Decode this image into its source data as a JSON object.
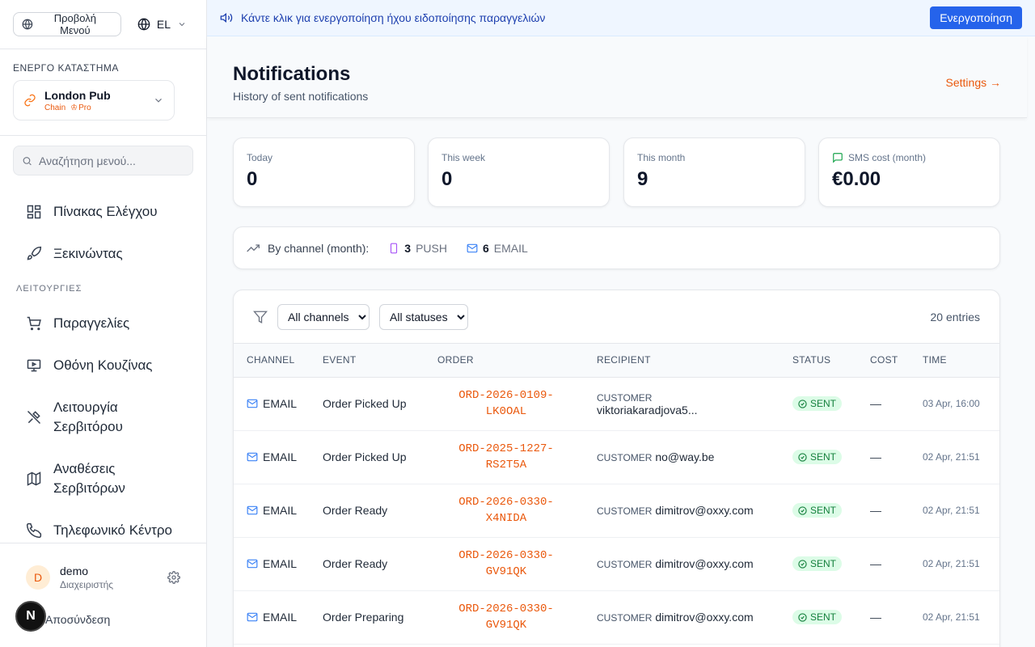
{
  "sidebar": {
    "menu_view_label": "Προβολή Μενού",
    "language": "EL",
    "store_caption": "ΕΝΕΡΓΟ ΚΑΤΑΣΤΗΜΑ",
    "store_name": "London Pub",
    "store_type": "Chain",
    "store_plan": "Pro",
    "search_placeholder": "Αναζήτηση μενού...",
    "nav_top": [
      {
        "label": "Πίνακας Ελέγχου",
        "icon": "dashboard-icon"
      },
      {
        "label": "Ξεκινώντας",
        "icon": "rocket-icon"
      }
    ],
    "section_label": "ΛΕΙΤΟΥΡΓΙΕΣ",
    "nav_ops": [
      {
        "label": "Παραγγελίες",
        "icon": "cart-icon"
      },
      {
        "label": "Οθόνη Κουζίνας",
        "icon": "monitor-icon"
      },
      {
        "label_line1": "Λειτουργία",
        "label_line2": "Σερβιτόρου",
        "icon": "utensils-icon"
      },
      {
        "label_line1": "Αναθέσεις",
        "label_line2": "Σερβιτόρων",
        "icon": "map-icon"
      },
      {
        "label": "Τηλεφωνικό Κέντρο",
        "icon": "phone-icon"
      }
    ],
    "user_initial": "D",
    "user_name": "demo",
    "user_role": "Διαχειριστής",
    "logout_label": "Αποσύνδεση",
    "badge_letter": "N"
  },
  "banner": {
    "text": "Κάντε κλικ για ενεργοποίηση ήχου ειδοποίησης παραγγελιών",
    "button_label": "Ενεργοποίηση"
  },
  "header": {
    "title": "Notifications",
    "subtitle": "History of sent notifications",
    "settings_link": "Settings →"
  },
  "stats": [
    {
      "label": "Today",
      "value": "0"
    },
    {
      "label": "This week",
      "value": "0"
    },
    {
      "label": "This month",
      "value": "9"
    },
    {
      "label": "SMS cost (month)",
      "value": "€0.00"
    }
  ],
  "channels": {
    "label": "By channel (month):",
    "push_count": "3",
    "push_label": "PUSH",
    "email_count": "6",
    "email_label": "EMAIL"
  },
  "filters": {
    "channel_selected": "All channels",
    "status_selected": "All statuses",
    "entries": "20 entries"
  },
  "table": {
    "headers": [
      "CHANNEL",
      "EVENT",
      "ORDER",
      "RECIPIENT",
      "STATUS",
      "COST",
      "TIME"
    ],
    "rows": [
      {
        "channel": "EMAIL",
        "event": "Order Picked Up",
        "order1": "ORD-2026-0109-",
        "order2": "LK0OAL",
        "rlabel": "CUSTOMER",
        "rval": "viktoriakaradjova5...",
        "status": "SENT",
        "cost": "—",
        "time": "03 Apr, 16:00"
      },
      {
        "channel": "EMAIL",
        "event": "Order Picked Up",
        "order1": "ORD-2025-1227-",
        "order2": "RS2T5A",
        "rlabel": "CUSTOMER",
        "rval": "no@way.be",
        "status": "SENT",
        "cost": "—",
        "time": "02 Apr, 21:51"
      },
      {
        "channel": "EMAIL",
        "event": "Order Ready",
        "order1": "ORD-2026-0330-",
        "order2": "X4NIDA",
        "rlabel": "CUSTOMER",
        "rval": "dimitrov@oxxy.com",
        "status": "SENT",
        "cost": "—",
        "time": "02 Apr, 21:51"
      },
      {
        "channel": "EMAIL",
        "event": "Order Ready",
        "order1": "ORD-2026-0330-",
        "order2": "GV91QK",
        "rlabel": "CUSTOMER",
        "rval": "dimitrov@oxxy.com",
        "status": "SENT",
        "cost": "—",
        "time": "02 Apr, 21:51"
      },
      {
        "channel": "EMAIL",
        "event": "Order Preparing",
        "order1": "ORD-2026-0330-",
        "order2": "GV91QK",
        "rlabel": "CUSTOMER",
        "rval": "dimitrov@oxxy.com",
        "status": "SENT",
        "cost": "—",
        "time": "02 Apr, 21:51"
      }
    ]
  },
  "colors": {
    "accent": "#ea580c",
    "primary_button": "#2563eb",
    "status_sent_bg": "#dcfce7",
    "status_sent_fg": "#15803d"
  }
}
